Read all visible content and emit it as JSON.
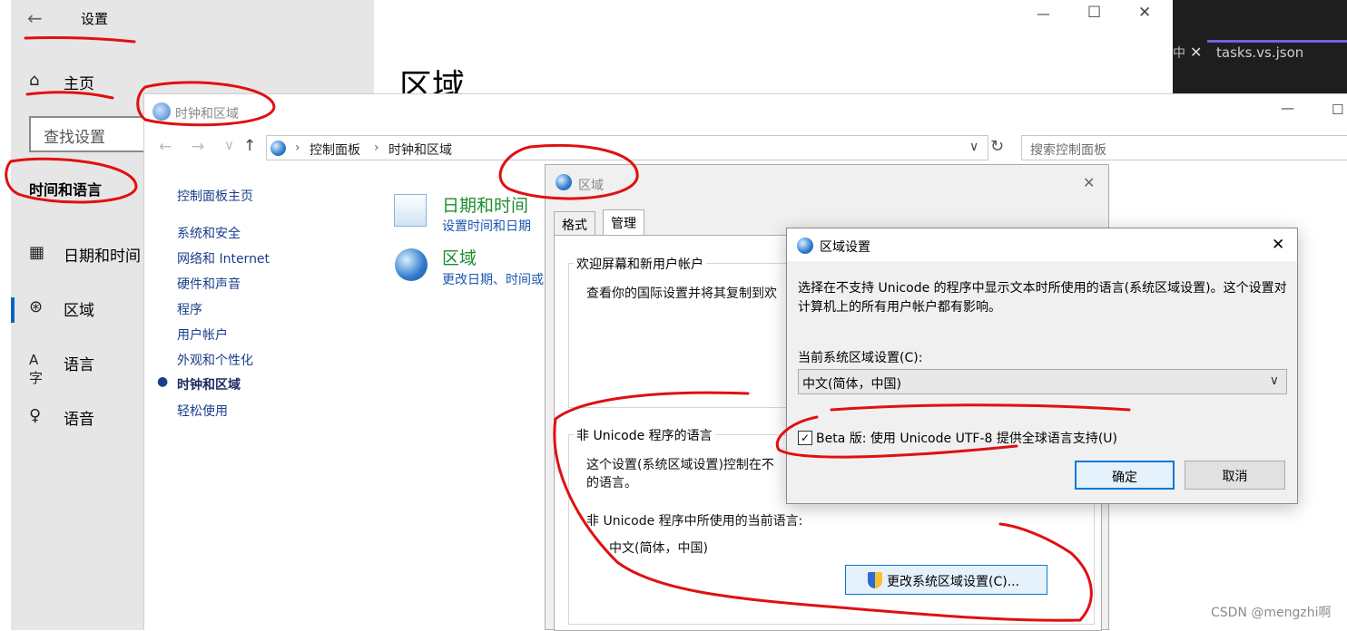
{
  "settings": {
    "title": "设置",
    "home": "主页",
    "search_placeholder": "查找设置",
    "section": "时间和语言",
    "nav": [
      {
        "label": "日期和时间",
        "icon": "calendar-clock-icon"
      },
      {
        "label": "区域",
        "icon": "globe-icon",
        "selected": true
      },
      {
        "label": "语言",
        "icon": "language-icon"
      },
      {
        "label": "语音",
        "icon": "microphone-icon"
      }
    ],
    "page_heading": "区域"
  },
  "vscode": {
    "tab_name": "tasks.vs.json",
    "tab_fragment": "中"
  },
  "control_panel": {
    "title": "时钟和区域",
    "breadcrumb": [
      "控制面板",
      "时钟和区域"
    ],
    "search_placeholder": "搜索控制面板",
    "nav": [
      "控制面板主页",
      "系统和安全",
      "网络和 Internet",
      "硬件和声音",
      "程序",
      "用户帐户",
      "外观和个性化",
      "时钟和区域",
      "轻松使用"
    ],
    "current_nav": "时钟和区域",
    "items": [
      {
        "title": "日期和时间",
        "link": "设置时间和日期",
        "icon": "calendar-clock-icon"
      },
      {
        "title": "区域",
        "link": "更改日期、时间或",
        "icon": "globe-icon"
      }
    ]
  },
  "region_dialog": {
    "title": "区域",
    "tabs": [
      "格式",
      "管理"
    ],
    "active_tab": "管理",
    "group_welcome": {
      "title": "欢迎屏幕和新用户帐户",
      "text": "查看你的国际设置并将其复制到欢"
    },
    "group_nonunicode": {
      "title": "非 Unicode 程序的语言",
      "text_line1": "这个设置(系统区域设置)控制在不",
      "text_line2": "的语言。",
      "current_label": "非 Unicode 程序中所使用的当前语言:",
      "current_value": "中文(简体，中国)",
      "change_button": "更改系统区域设置(C)..."
    }
  },
  "region_settings": {
    "title": "区域设置",
    "description": "选择在不支持 Unicode 的程序中显示文本时所使用的语言(系统区域设置)。这个设置对计算机上的所有用户帐户都有影响。",
    "current_label": "当前系统区域设置(C):",
    "current_value": "中文(简体，中国)",
    "beta_checkbox": "Beta 版: 使用 Unicode UTF-8 提供全球语言支持(U)",
    "beta_checked": true,
    "ok": "确定",
    "cancel": "取消"
  },
  "watermark": "CSDN @mengzhi啊",
  "colors": {
    "annotation": "#e01010",
    "accent": "#0067c0",
    "link_green": "#1e8d32",
    "link_blue": "#1a56b0"
  }
}
